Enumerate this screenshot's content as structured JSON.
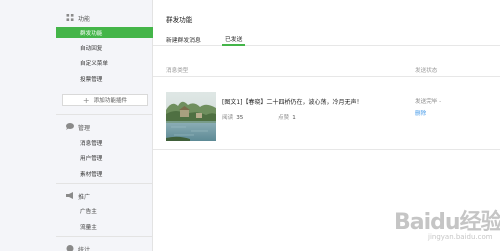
{
  "sidebar": {
    "groups": [
      {
        "label": "功能",
        "icon": "grid-icon",
        "items": [
          {
            "label": "群发功能",
            "active": true
          },
          {
            "label": "自动回复"
          },
          {
            "label": "自定义菜单"
          },
          {
            "label": "投票管理"
          }
        ]
      },
      {
        "label": "管理",
        "icon": "chat-icon",
        "items": [
          {
            "label": "消息管理"
          },
          {
            "label": "用户管理"
          },
          {
            "label": "素材管理"
          }
        ]
      },
      {
        "label": "推广",
        "icon": "megaphone-icon",
        "items": [
          {
            "label": "广告主"
          },
          {
            "label": "流量主"
          }
        ]
      },
      {
        "label": "统计",
        "icon": "chart-icon",
        "items": []
      }
    ],
    "add_plugin_label": "添加功能插件",
    "add_plugin_symbol": "+"
  },
  "main": {
    "title": "群发功能",
    "tabs": [
      {
        "label": "新建群发消息"
      },
      {
        "label": "已发送",
        "active": true
      }
    ],
    "table": {
      "col_message_type": "消息类型",
      "col_send_status": "发送状态",
      "rows": [
        {
          "title": "[图文1]【春晓】二十四桥仍在，波心荡，冷月无声！",
          "reads_label": "阅读",
          "reads": "35",
          "likes_label": "点赞",
          "likes": "1",
          "status": "发送完毕 -",
          "delete_label": "删除"
        }
      ]
    }
  },
  "watermark": {
    "brand": "Baidu经验",
    "sub": "jingyan.baidu.com"
  },
  "colors": {
    "accent": "#44b549",
    "link": "#459ae9",
    "sidebar_bg": "#f4f5f9"
  }
}
